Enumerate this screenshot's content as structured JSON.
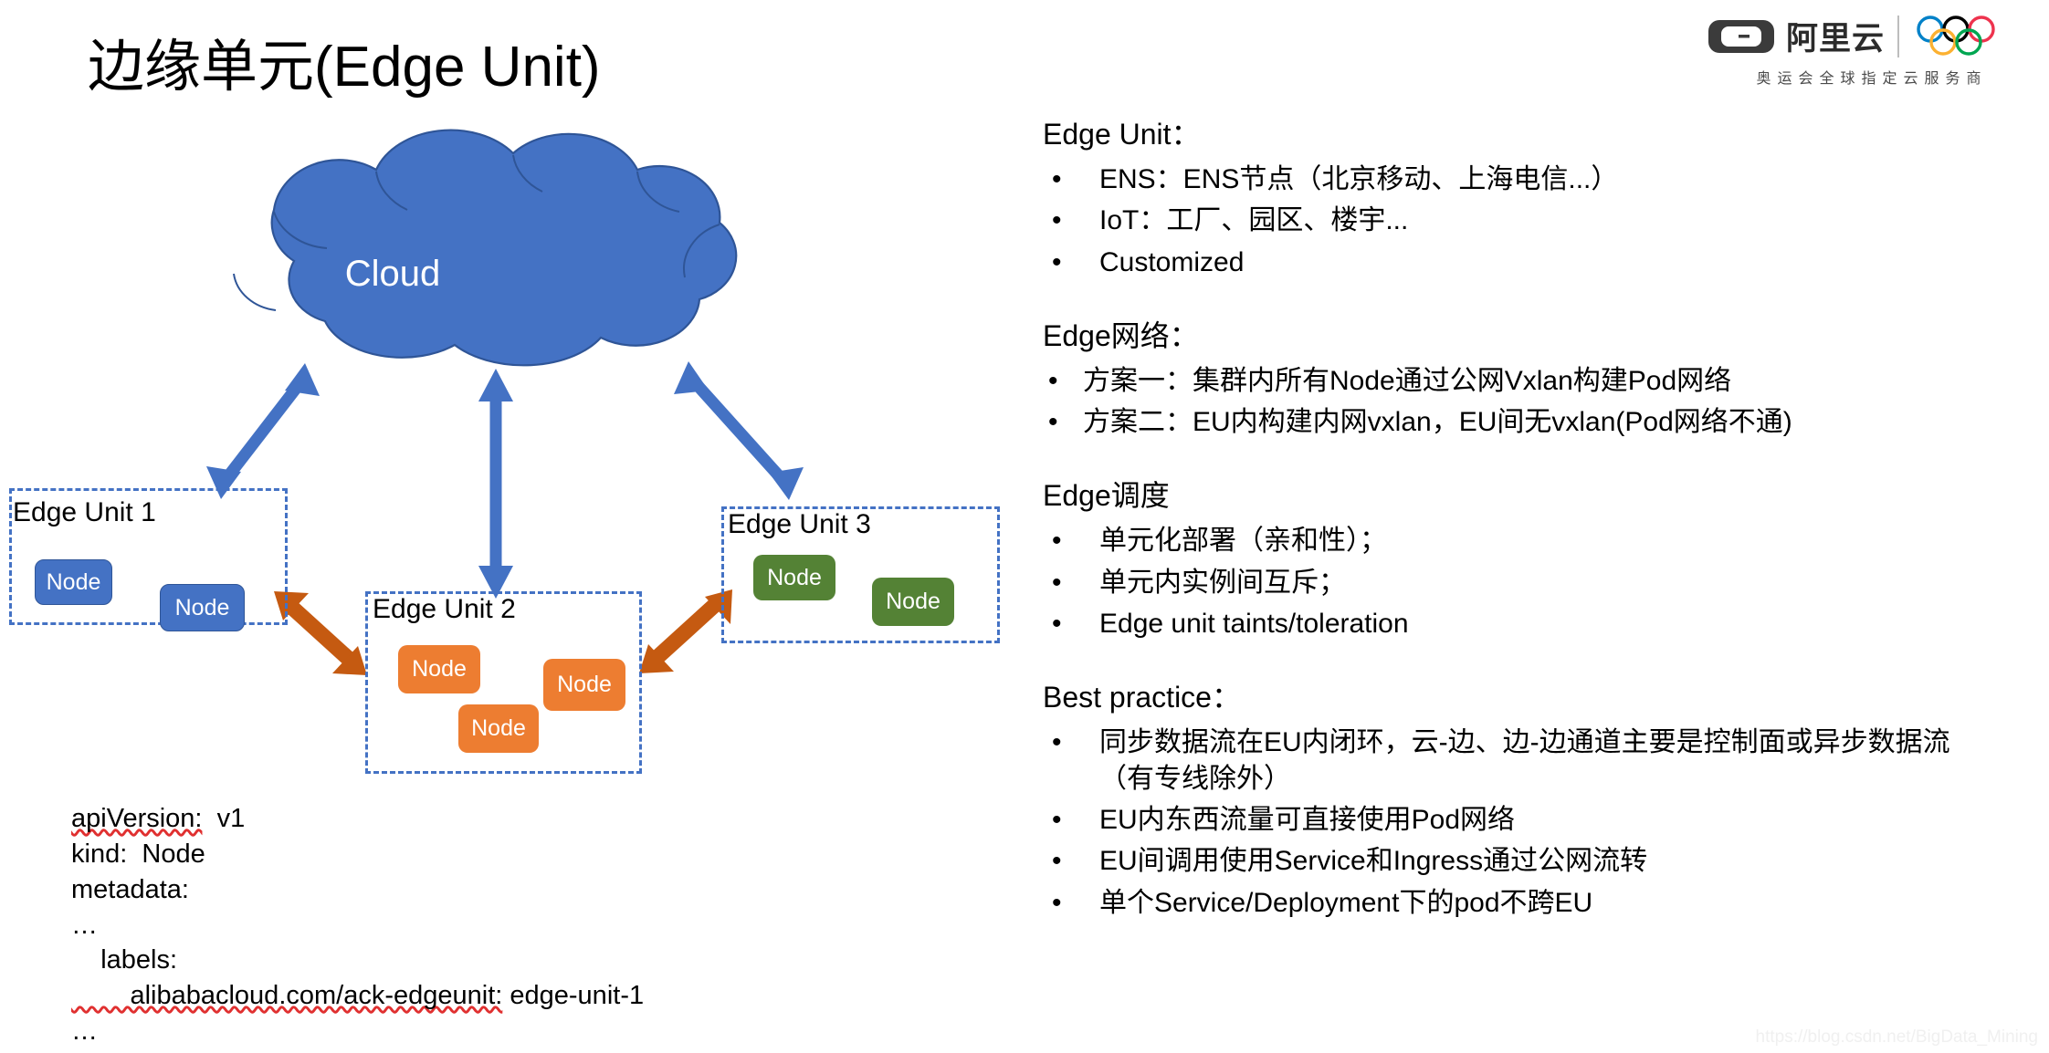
{
  "title": "边缘单元(Edge Unit)",
  "logo": {
    "brand_cn": "阿里云",
    "tagline": "奥运会全球指定云服务商",
    "ring_colors": [
      "#0081C8",
      "#000000",
      "#EE334E",
      "#FCB131",
      "#00A651"
    ]
  },
  "colors": {
    "cloud": "#4472C4",
    "node_blue": "#4472C4",
    "node_orange": "#ED7D31",
    "node_green": "#548235",
    "arrow_blue": "#4472C4",
    "arrow_orange": "#C55A11",
    "dashed_border": "#4472C4"
  },
  "diagram": {
    "cloud_label": "Cloud",
    "units": [
      {
        "title": "Edge Unit 1",
        "color": "blue",
        "nodes": [
          "Node",
          "Node"
        ]
      },
      {
        "title": "Edge Unit 2",
        "color": "orange",
        "nodes": [
          "Node",
          "Node",
          "Node"
        ]
      },
      {
        "title": "Edge Unit 3",
        "color": "green",
        "nodes": [
          "Node",
          "Node"
        ]
      }
    ]
  },
  "yaml": {
    "line1_key": "apiVersion:",
    "line1_val": "  v1",
    "line2": "kind:  Node",
    "line3": "metadata:",
    "line4": "…",
    "line5": "    labels:",
    "line6_key": "        alibabacloud.com/ack-edgeunit:",
    "line6_val": " edge-unit-1",
    "line7": "…"
  },
  "sections": [
    {
      "head": "Edge Unit：",
      "indent": "wide",
      "bullets": [
        "ENS：ENS节点（北京移动、上海电信...）",
        "IoT：工厂、园区、楼宇...",
        "Customized"
      ]
    },
    {
      "head": "Edge网络：",
      "indent": "narrow",
      "bullets": [
        "方案一：集群内所有Node通过公网Vxlan构建Pod网络",
        "方案二：EU内构建内网vxlan，EU间无vxlan(Pod网络不通)"
      ]
    },
    {
      "head": "Edge调度",
      "indent": "wide",
      "bullets": [
        "单元化部署（亲和性）；",
        "单元内实例间互斥；",
        "Edge unit taints/toleration"
      ]
    },
    {
      "head": "Best practice：",
      "indent": "wide",
      "bullets": [
        "同步数据流在EU内闭环，云-边、边-边通道主要是控制面或异步数据流",
        "EU内东西流量可直接使用Pod网络",
        "EU间调用使用Service和Ingress通过公网流转",
        "单个Service/Deployment下的pod不跨EU"
      ],
      "continuation_after_first": "（有专线除外）"
    }
  ],
  "bullet_glyph": "•",
  "watermark": "https://blog.csdn.net/BigData_Mining"
}
